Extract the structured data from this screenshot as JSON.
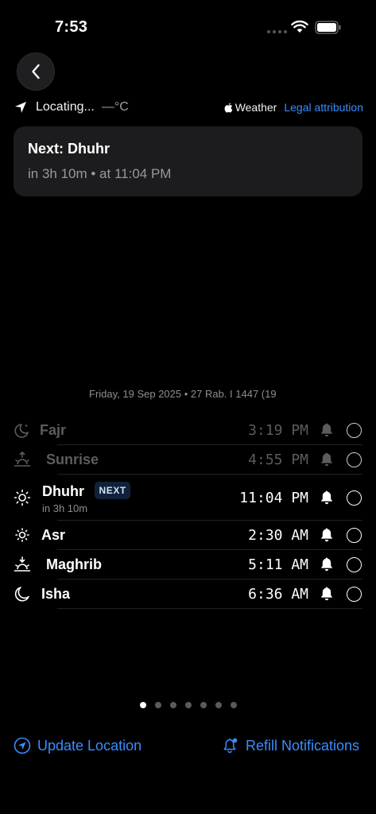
{
  "status_bar": {
    "time": "7:53"
  },
  "location": {
    "label": "Locating...",
    "temperature": "—°C"
  },
  "weather": {
    "label": "Weather",
    "legal_link": "Legal attribution"
  },
  "next_card": {
    "title": "Next: Dhuhr",
    "subtitle": "in 3h 10m • at 11:04 PM"
  },
  "date_line": "Friday, 19 Sep 2025  •  27 Rab. I 1447 (19",
  "prayers": [
    {
      "name": "Fajr",
      "time": "3:19 PM",
      "icon": "moon-star-icon",
      "state": "past"
    },
    {
      "name": "Sunrise",
      "time": "4:55 PM",
      "icon": "sunrise-icon",
      "state": "past"
    },
    {
      "name": "Dhuhr",
      "time": "11:04 PM",
      "icon": "sun-icon",
      "state": "next",
      "badge": "NEXT",
      "countdown": "in 3h 10m"
    },
    {
      "name": "Asr",
      "time": "2:30 AM",
      "icon": "sun-small-icon",
      "state": "upcoming"
    },
    {
      "name": "Maghrib",
      "time": "5:11 AM",
      "icon": "sunset-icon",
      "state": "upcoming"
    },
    {
      "name": "Isha",
      "time": "6:36 AM",
      "icon": "moon-icon",
      "state": "upcoming"
    }
  ],
  "pager": {
    "count": 7,
    "active_index": 0
  },
  "actions": {
    "update_location": "Update Location",
    "refill_notifications": "Refill Notifications"
  },
  "colors": {
    "accent": "#3a8dff",
    "card": "#1c1c1e",
    "background": "#000000"
  }
}
